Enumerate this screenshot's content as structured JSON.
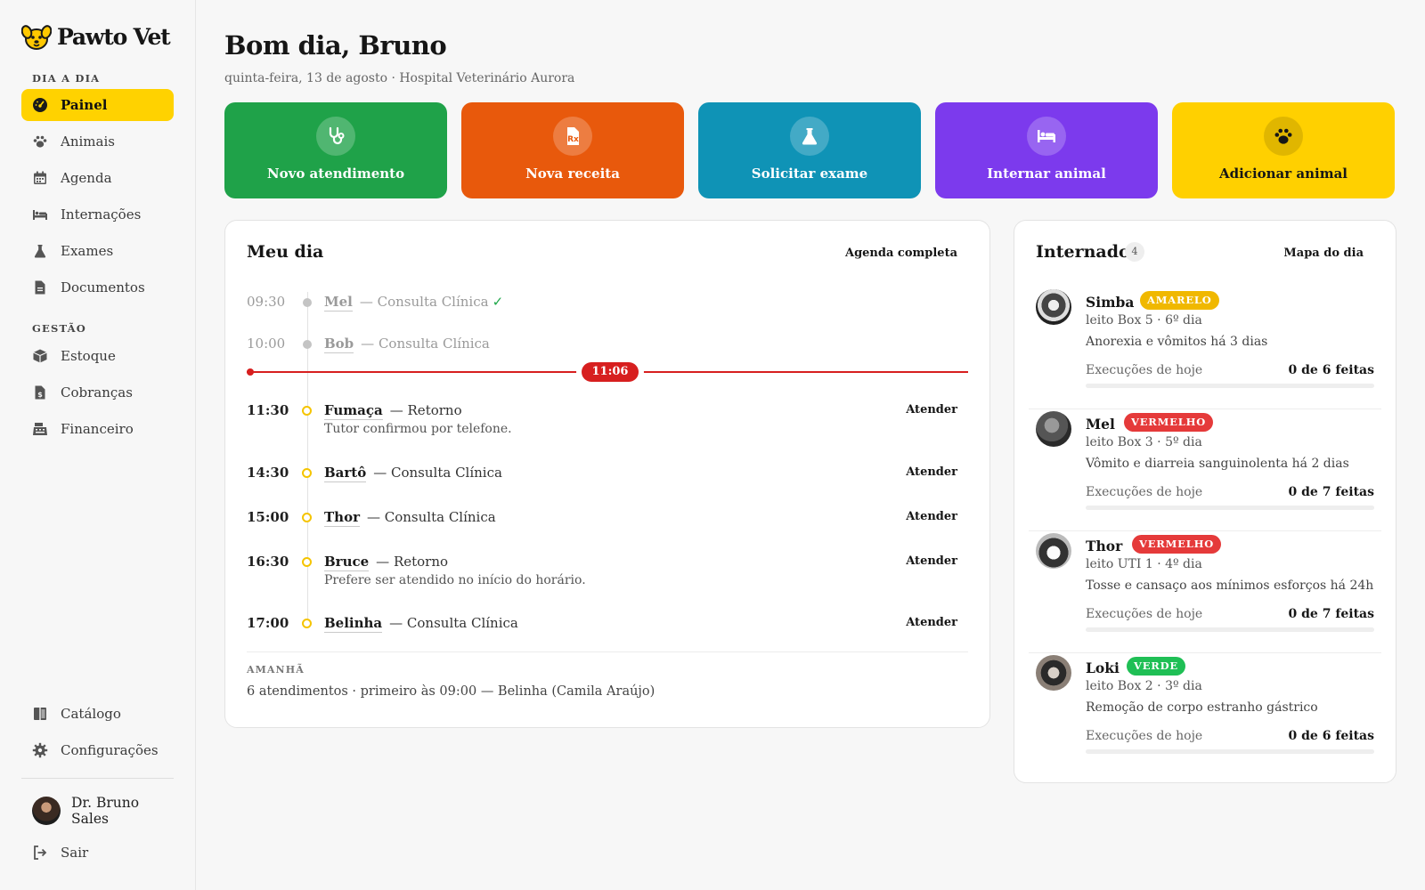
{
  "brand": {
    "name": "Pawto Vet"
  },
  "sidebar": {
    "section_day": "DIA A DIA",
    "section_mgmt": "GESTÃO",
    "items": [
      {
        "label": "Painel",
        "icon": "gauge-icon"
      },
      {
        "label": "Animais",
        "icon": "paw-icon"
      },
      {
        "label": "Agenda",
        "icon": "calendar-icon"
      },
      {
        "label": "Internações",
        "icon": "bed-icon"
      },
      {
        "label": "Exames",
        "icon": "flask-icon"
      },
      {
        "label": "Documentos",
        "icon": "document-icon"
      }
    ],
    "mgmt_items": [
      {
        "label": "Estoque",
        "icon": "box-icon"
      },
      {
        "label": "Cobranças",
        "icon": "invoice-icon"
      },
      {
        "label": "Financeiro",
        "icon": "cash-register-icon"
      }
    ],
    "bottom_items": [
      {
        "label": "Catálogo",
        "icon": "book-icon"
      },
      {
        "label": "Configurações",
        "icon": "gear-icon"
      }
    ],
    "user": "Dr. Bruno Sales",
    "logout": "Sair"
  },
  "header": {
    "greeting": "Bom dia, Bruno",
    "subtitle": "quinta-feira, 13 de agosto · Hospital Veterinário Aurora"
  },
  "actions": [
    {
      "label": "Novo atendimento",
      "color": "#1fa249",
      "icon": "stethoscope-icon"
    },
    {
      "label": "Nova receita",
      "color": "#e8590c",
      "icon": "prescription-icon"
    },
    {
      "label": "Solicitar exame",
      "color": "#0f93b6",
      "icon": "flask-icon"
    },
    {
      "label": "Internar animal",
      "color": "#7c3aed",
      "icon": "bed-icon"
    },
    {
      "label": "Adicionar animal",
      "color": "#ffd000",
      "icon": "paw-icon"
    }
  ],
  "my_day": {
    "title": "Meu dia",
    "link": "Agenda completa",
    "now": "11:06",
    "attend_label": "Atender",
    "appointments": [
      {
        "time": "09:30",
        "pet": "Mel",
        "service": "— Consulta Clínica",
        "status": "done"
      },
      {
        "time": "10:00",
        "pet": "Bob",
        "service": "— Consulta Clínica",
        "status": "past"
      },
      {
        "time": "11:30",
        "pet": "Fumaça",
        "service": "— Retorno",
        "note": "Tutor confirmou por telefone.",
        "status": "upcoming"
      },
      {
        "time": "14:30",
        "pet": "Bartô",
        "service": "— Consulta Clínica",
        "status": "upcoming"
      },
      {
        "time": "15:00",
        "pet": "Thor",
        "service": "— Consulta Clínica",
        "status": "upcoming"
      },
      {
        "time": "16:30",
        "pet": "Bruce",
        "service": "— Retorno",
        "note": "Prefere ser atendido no início do horário.",
        "status": "upcoming"
      },
      {
        "time": "17:00",
        "pet": "Belinha",
        "service": "— Consulta Clínica",
        "status": "upcoming"
      }
    ],
    "tomorrow_label": "AMANHÃ",
    "tomorrow_text": "6 atendimentos · primeiro às 09:00 — Belinha (Camila Araújo)"
  },
  "inpatients": {
    "title": "Internados",
    "count": "4",
    "link": "Mapa do dia",
    "exec_label": "Execuções de hoje",
    "patients": [
      {
        "name": "Simba",
        "tag": "AMARELO",
        "tag_color": "yellow",
        "bed": "leito Box 5 · 6º dia",
        "desc": "Anorexia e vômitos há 3 dias",
        "exec": "0 de 6 feitas",
        "progress": 0
      },
      {
        "name": "Mel",
        "tag": "VERMELHO",
        "tag_color": "red",
        "bed": "leito Box 3 · 5º dia",
        "desc": "Vômito e diarreia sanguinolenta há 2 dias",
        "exec": "0 de 7 feitas",
        "progress": 0
      },
      {
        "name": "Thor",
        "tag": "VERMELHO",
        "tag_color": "red",
        "bed": "leito UTI 1 · 4º dia",
        "desc": "Tosse e cansaço aos mínimos esforços há 24h",
        "exec": "0 de 7 feitas",
        "progress": 0
      },
      {
        "name": "Loki",
        "tag": "VERDE",
        "tag_color": "green",
        "bed": "leito Box 2 · 3º dia",
        "desc": "Remoção de corpo estranho gástrico",
        "exec": "0 de 6 feitas",
        "progress": 0
      }
    ]
  }
}
